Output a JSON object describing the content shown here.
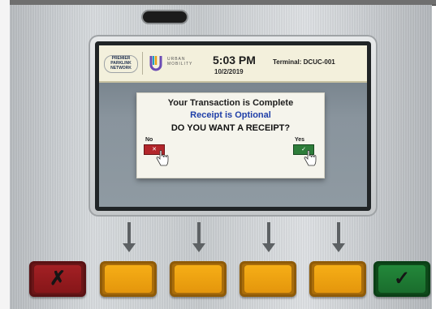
{
  "kiosk": {
    "logo_left_lines": [
      "PREMIER",
      "PARKLINK",
      "NETWORK"
    ],
    "brand_logo_text": [
      "URBAN",
      "MOBILITY"
    ],
    "time": "5:03 PM",
    "date": "10/2/2019",
    "terminal": "Terminal: DCUC-001"
  },
  "dialog": {
    "title": "Your Transaction is Complete",
    "subtitle": "Receipt is Optional",
    "question": "DO YOU WANT A RECEIPT?",
    "no_label": "No",
    "yes_label": "Yes"
  },
  "keys": {
    "cancel_icon": "x-icon",
    "confirm_icon": "check-icon",
    "cancel_glyph": "✗",
    "confirm_glyph": "✓",
    "amber_count_note": "",
    "colors": {
      "cancel": "#a32024",
      "function": "#f6ae16",
      "confirm": "#23883a"
    }
  }
}
